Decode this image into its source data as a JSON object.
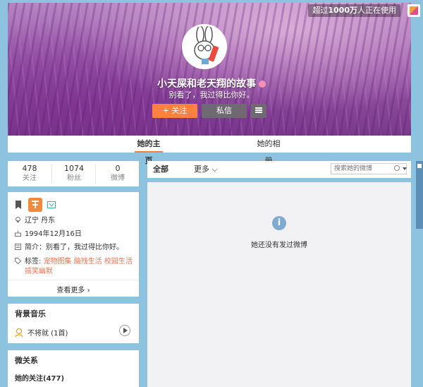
{
  "cover": {
    "usage_prefix": "超过",
    "usage_count": "1000万",
    "usage_suffix": "人正在使用"
  },
  "profile": {
    "name": "小天屎和老天翔的故事",
    "bio": "别看了，我过得比你好。",
    "follow_label": "+ 关注",
    "message_label": "私信"
  },
  "tabs": {
    "home": "她的主页",
    "album": "她的相册"
  },
  "stats": [
    {
      "value": "478",
      "label": "关注"
    },
    {
      "value": "1074",
      "label": "粉丝"
    },
    {
      "value": "0",
      "label": "微博"
    }
  ],
  "info": {
    "location": "辽宁 丹东",
    "birthday": "1994年12月16日",
    "intro": "简介：别看了，我过得比你好。",
    "tags_label": "标签:",
    "tags_line1": "宠物图集 脑残生活 校园生活",
    "tags_line2": "搞笑幽默",
    "more": "查看更多 ›"
  },
  "music": {
    "title": "背景音乐",
    "track": "不将就 (1首)"
  },
  "relations": {
    "title": "微关系",
    "following": "她的关注(477)"
  },
  "feed": {
    "tab_all": "全部",
    "tab_more": "更多 ⌵",
    "search_placeholder": "搜索她的微博",
    "empty_text": "她还没有发过微博"
  }
}
